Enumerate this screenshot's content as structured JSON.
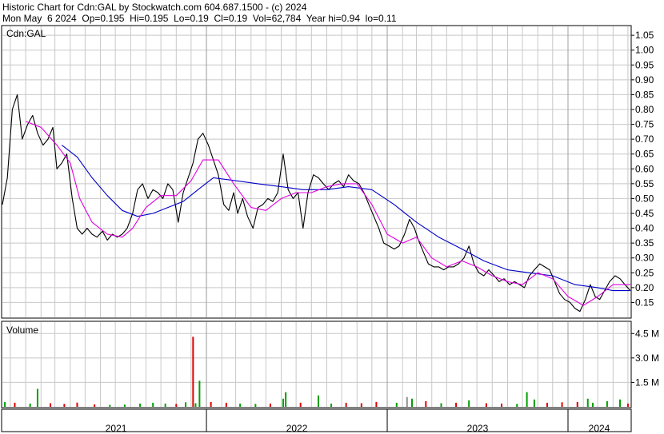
{
  "header": {
    "line1": "Historic Chart for Cdn:GAL by Stockwatch.com 604.687.1500 - (c) 2024",
    "line2": "Mon May  6 2024  Op=0.195  Hi=0.195  Lo=0.19  Cl=0.19  Vol=62,784  Year hi=0.94  lo=0.11"
  },
  "chart_data": {
    "type": "line",
    "symbol_label": "Cdn:GAL",
    "volume_label": "Volume",
    "price_axis": {
      "ylim": [
        0.1,
        1.08
      ],
      "ticks": [
        1.05,
        1.0,
        0.95,
        0.9,
        0.85,
        0.8,
        0.75,
        0.7,
        0.65,
        0.6,
        0.55,
        0.5,
        0.45,
        0.4,
        0.35,
        0.3,
        0.25,
        0.2,
        0.15
      ],
      "tick_labels": [
        "1.05",
        "1.00",
        "0.95",
        "0.90",
        "0.85",
        "0.80",
        "0.75",
        "0.70",
        "0.65",
        "0.60",
        "0.55",
        "0.50",
        "0.45",
        "0.40",
        "0.35",
        "0.30",
        "0.25",
        "0.20",
        "0.15"
      ]
    },
    "volume_axis": {
      "ylim": [
        0,
        5200000
      ],
      "ticks": [
        4500000,
        3000000,
        1500000
      ],
      "tick_labels": [
        "4.5 M",
        "3.0 M",
        "1.5 M"
      ]
    },
    "x_axis": {
      "start": "2020-11-15",
      "end": "2024-05-06",
      "years": [
        {
          "label": "2021",
          "start": "2021-01-01"
        },
        {
          "label": "2022",
          "start": "2022-01-01"
        },
        {
          "label": "2023",
          "start": "2023-01-01"
        },
        {
          "label": "2024",
          "start": "2024-01-01"
        }
      ]
    },
    "grid": true,
    "colors": {
      "price": "#000000",
      "ma_short": "#e000e0",
      "ma_long": "#0000c8",
      "volume_up": "#00a000",
      "volume_down": "#e00000",
      "volume_neutral": "#909090",
      "grid": "#c8c8c8"
    },
    "series": [
      {
        "key": "price",
        "points": [
          [
            "2020-11-15",
            0.48
          ],
          [
            "2020-11-25",
            0.57
          ],
          [
            "2020-12-05",
            0.8
          ],
          [
            "2020-12-15",
            0.85
          ],
          [
            "2020-12-25",
            0.7
          ],
          [
            "2021-01-05",
            0.75
          ],
          [
            "2021-01-15",
            0.78
          ],
          [
            "2021-01-25",
            0.72
          ],
          [
            "2021-02-05",
            0.68
          ],
          [
            "2021-02-15",
            0.7
          ],
          [
            "2021-02-25",
            0.74
          ],
          [
            "2021-03-05",
            0.6
          ],
          [
            "2021-03-15",
            0.62
          ],
          [
            "2021-03-25",
            0.65
          ],
          [
            "2021-04-05",
            0.5
          ],
          [
            "2021-04-15",
            0.4
          ],
          [
            "2021-04-25",
            0.38
          ],
          [
            "2021-05-05",
            0.4
          ],
          [
            "2021-05-15",
            0.38
          ],
          [
            "2021-05-25",
            0.37
          ],
          [
            "2021-06-05",
            0.39
          ],
          [
            "2021-06-15",
            0.36
          ],
          [
            "2021-06-25",
            0.38
          ],
          [
            "2021-07-05",
            0.37
          ],
          [
            "2021-07-15",
            0.38
          ],
          [
            "2021-07-25",
            0.4
          ],
          [
            "2021-08-05",
            0.45
          ],
          [
            "2021-08-15",
            0.53
          ],
          [
            "2021-08-25",
            0.55
          ],
          [
            "2021-09-05",
            0.5
          ],
          [
            "2021-09-15",
            0.53
          ],
          [
            "2021-09-25",
            0.52
          ],
          [
            "2021-10-05",
            0.5
          ],
          [
            "2021-10-15",
            0.55
          ],
          [
            "2021-10-25",
            0.53
          ],
          [
            "2021-11-05",
            0.42
          ],
          [
            "2021-11-15",
            0.52
          ],
          [
            "2021-11-25",
            0.57
          ],
          [
            "2021-12-05",
            0.62
          ],
          [
            "2021-12-15",
            0.7
          ],
          [
            "2021-12-25",
            0.72
          ],
          [
            "2022-01-05",
            0.68
          ],
          [
            "2022-01-15",
            0.63
          ],
          [
            "2022-01-25",
            0.58
          ],
          [
            "2022-02-05",
            0.48
          ],
          [
            "2022-02-15",
            0.46
          ],
          [
            "2022-02-25",
            0.52
          ],
          [
            "2022-03-05",
            0.45
          ],
          [
            "2022-03-15",
            0.5
          ],
          [
            "2022-03-25",
            0.44
          ],
          [
            "2022-04-05",
            0.4
          ],
          [
            "2022-04-15",
            0.47
          ],
          [
            "2022-04-25",
            0.48
          ],
          [
            "2022-05-05",
            0.5
          ],
          [
            "2022-05-15",
            0.49
          ],
          [
            "2022-05-25",
            0.52
          ],
          [
            "2022-06-05",
            0.65
          ],
          [
            "2022-06-15",
            0.53
          ],
          [
            "2022-06-25",
            0.5
          ],
          [
            "2022-07-05",
            0.52
          ],
          [
            "2022-07-15",
            0.4
          ],
          [
            "2022-07-25",
            0.52
          ],
          [
            "2022-08-05",
            0.58
          ],
          [
            "2022-08-15",
            0.57
          ],
          [
            "2022-08-25",
            0.55
          ],
          [
            "2022-09-05",
            0.53
          ],
          [
            "2022-09-15",
            0.55
          ],
          [
            "2022-09-25",
            0.56
          ],
          [
            "2022-10-05",
            0.54
          ],
          [
            "2022-10-15",
            0.58
          ],
          [
            "2022-10-25",
            0.56
          ],
          [
            "2022-11-05",
            0.55
          ],
          [
            "2022-11-15",
            0.52
          ],
          [
            "2022-11-25",
            0.48
          ],
          [
            "2022-12-05",
            0.44
          ],
          [
            "2022-12-15",
            0.4
          ],
          [
            "2022-12-25",
            0.35
          ],
          [
            "2023-01-05",
            0.34
          ],
          [
            "2023-01-15",
            0.33
          ],
          [
            "2023-01-25",
            0.34
          ],
          [
            "2023-02-05",
            0.38
          ],
          [
            "2023-02-15",
            0.43
          ],
          [
            "2023-02-25",
            0.4
          ],
          [
            "2023-03-05",
            0.36
          ],
          [
            "2023-03-15",
            0.32
          ],
          [
            "2023-03-25",
            0.28
          ],
          [
            "2023-04-05",
            0.27
          ],
          [
            "2023-04-15",
            0.27
          ],
          [
            "2023-04-25",
            0.26
          ],
          [
            "2023-05-05",
            0.27
          ],
          [
            "2023-05-15",
            0.27
          ],
          [
            "2023-05-25",
            0.28
          ],
          [
            "2023-06-05",
            0.3
          ],
          [
            "2023-06-15",
            0.34
          ],
          [
            "2023-06-25",
            0.28
          ],
          [
            "2023-07-05",
            0.25
          ],
          [
            "2023-07-15",
            0.24
          ],
          [
            "2023-07-25",
            0.26
          ],
          [
            "2023-08-05",
            0.24
          ],
          [
            "2023-08-15",
            0.22
          ],
          [
            "2023-08-25",
            0.23
          ],
          [
            "2023-09-05",
            0.21
          ],
          [
            "2023-09-15",
            0.22
          ],
          [
            "2023-09-25",
            0.21
          ],
          [
            "2023-10-05",
            0.2
          ],
          [
            "2023-10-15",
            0.24
          ],
          [
            "2023-10-25",
            0.26
          ],
          [
            "2023-11-05",
            0.28
          ],
          [
            "2023-11-15",
            0.27
          ],
          [
            "2023-11-25",
            0.26
          ],
          [
            "2023-12-05",
            0.22
          ],
          [
            "2023-12-15",
            0.18
          ],
          [
            "2023-12-25",
            0.16
          ],
          [
            "2024-01-05",
            0.15
          ],
          [
            "2024-01-15",
            0.13
          ],
          [
            "2024-01-25",
            0.12
          ],
          [
            "2024-02-05",
            0.16
          ],
          [
            "2024-02-15",
            0.21
          ],
          [
            "2024-02-25",
            0.17
          ],
          [
            "2024-03-05",
            0.16
          ],
          [
            "2024-03-15",
            0.19
          ],
          [
            "2024-03-25",
            0.22
          ],
          [
            "2024-04-05",
            0.24
          ],
          [
            "2024-04-15",
            0.23
          ],
          [
            "2024-04-25",
            0.21
          ],
          [
            "2024-05-06",
            0.19
          ]
        ]
      },
      {
        "key": "ma_short",
        "points": [
          [
            "2021-01-01",
            0.76
          ],
          [
            "2021-02-01",
            0.74
          ],
          [
            "2021-03-05",
            0.68
          ],
          [
            "2021-04-01",
            0.62
          ],
          [
            "2021-04-20",
            0.5
          ],
          [
            "2021-05-15",
            0.42
          ],
          [
            "2021-06-15",
            0.38
          ],
          [
            "2021-07-15",
            0.37
          ],
          [
            "2021-08-05",
            0.4
          ],
          [
            "2021-09-01",
            0.47
          ],
          [
            "2021-10-01",
            0.51
          ],
          [
            "2021-11-01",
            0.51
          ],
          [
            "2021-12-01",
            0.56
          ],
          [
            "2021-12-25",
            0.63
          ],
          [
            "2022-01-25",
            0.63
          ],
          [
            "2022-02-25",
            0.55
          ],
          [
            "2022-04-01",
            0.47
          ],
          [
            "2022-05-01",
            0.46
          ],
          [
            "2022-06-01",
            0.5
          ],
          [
            "2022-07-01",
            0.52
          ],
          [
            "2022-08-01",
            0.52
          ],
          [
            "2022-09-01",
            0.54
          ],
          [
            "2022-10-01",
            0.55
          ],
          [
            "2022-11-01",
            0.55
          ],
          [
            "2022-12-01",
            0.48
          ],
          [
            "2023-01-01",
            0.38
          ],
          [
            "2023-02-01",
            0.35
          ],
          [
            "2023-03-01",
            0.37
          ],
          [
            "2023-04-01",
            0.3
          ],
          [
            "2023-05-01",
            0.27
          ],
          [
            "2023-06-01",
            0.29
          ],
          [
            "2023-07-01",
            0.27
          ],
          [
            "2023-08-01",
            0.24
          ],
          [
            "2023-09-01",
            0.22
          ],
          [
            "2023-10-01",
            0.21
          ],
          [
            "2023-11-01",
            0.25
          ],
          [
            "2023-12-01",
            0.23
          ],
          [
            "2024-01-01",
            0.17
          ],
          [
            "2024-02-01",
            0.14
          ],
          [
            "2024-03-01",
            0.17
          ],
          [
            "2024-04-01",
            0.21
          ],
          [
            "2024-05-06",
            0.21
          ]
        ]
      },
      {
        "key": "ma_long",
        "points": [
          [
            "2021-03-15",
            0.68
          ],
          [
            "2021-04-15",
            0.64
          ],
          [
            "2021-05-15",
            0.57
          ],
          [
            "2021-06-15",
            0.51
          ],
          [
            "2021-07-15",
            0.46
          ],
          [
            "2021-08-15",
            0.44
          ],
          [
            "2021-09-15",
            0.45
          ],
          [
            "2021-10-15",
            0.47
          ],
          [
            "2021-11-15",
            0.49
          ],
          [
            "2021-12-15",
            0.53
          ],
          [
            "2022-01-15",
            0.57
          ],
          [
            "2022-03-01",
            0.56
          ],
          [
            "2022-04-15",
            0.55
          ],
          [
            "2022-06-01",
            0.54
          ],
          [
            "2022-07-15",
            0.53
          ],
          [
            "2022-09-01",
            0.53
          ],
          [
            "2022-10-15",
            0.54
          ],
          [
            "2022-12-01",
            0.53
          ],
          [
            "2023-01-15",
            0.48
          ],
          [
            "2023-03-01",
            0.42
          ],
          [
            "2023-04-15",
            0.37
          ],
          [
            "2023-06-01",
            0.33
          ],
          [
            "2023-07-15",
            0.29
          ],
          [
            "2023-09-01",
            0.26
          ],
          [
            "2023-10-15",
            0.25
          ],
          [
            "2023-12-01",
            0.24
          ],
          [
            "2024-01-15",
            0.21
          ],
          [
            "2024-03-01",
            0.2
          ],
          [
            "2024-04-01",
            0.19
          ],
          [
            "2024-05-06",
            0.19
          ]
        ]
      }
    ],
    "volume": {
      "points": [
        [
          "2020-11-20",
          300000,
          "up"
        ],
        [
          "2020-12-10",
          250000,
          "down"
        ],
        [
          "2021-01-10",
          200000,
          "up"
        ],
        [
          "2021-01-25",
          1100000,
          "up"
        ],
        [
          "2021-02-20",
          220000,
          "down"
        ],
        [
          "2021-03-20",
          180000,
          "down"
        ],
        [
          "2021-04-15",
          260000,
          "down"
        ],
        [
          "2021-05-20",
          150000,
          "down"
        ],
        [
          "2021-06-20",
          120000,
          "up"
        ],
        [
          "2021-07-20",
          140000,
          "up"
        ],
        [
          "2021-08-20",
          200000,
          "up"
        ],
        [
          "2021-09-15",
          250000,
          "up"
        ],
        [
          "2021-10-10",
          200000,
          "up"
        ],
        [
          "2021-11-01",
          180000,
          "down"
        ],
        [
          "2021-11-20",
          280000,
          "up"
        ],
        [
          "2021-12-05",
          4300000,
          "down"
        ],
        [
          "2021-12-10",
          220000,
          "up"
        ],
        [
          "2021-12-18",
          1600000,
          "up"
        ],
        [
          "2022-01-10",
          300000,
          "down"
        ],
        [
          "2022-02-10",
          250000,
          "down"
        ],
        [
          "2022-03-10",
          200000,
          "up"
        ],
        [
          "2022-04-10",
          180000,
          "up"
        ],
        [
          "2022-05-10",
          200000,
          "down"
        ],
        [
          "2022-06-05",
          500000,
          "up"
        ],
        [
          "2022-06-10",
          900000,
          "up"
        ],
        [
          "2022-07-10",
          250000,
          "down"
        ],
        [
          "2022-08-15",
          700000,
          "up"
        ],
        [
          "2022-09-10",
          200000,
          "up"
        ],
        [
          "2022-10-10",
          250000,
          "down"
        ],
        [
          "2022-11-10",
          220000,
          "down"
        ],
        [
          "2022-12-10",
          300000,
          "down"
        ],
        [
          "2023-01-20",
          250000,
          "up"
        ],
        [
          "2023-02-10",
          600000,
          "neutral"
        ],
        [
          "2023-02-20",
          500000,
          "up"
        ],
        [
          "2023-03-20",
          350000,
          "down"
        ],
        [
          "2023-04-20",
          220000,
          "up"
        ],
        [
          "2023-05-20",
          250000,
          "down"
        ],
        [
          "2023-06-15",
          400000,
          "up"
        ],
        [
          "2023-07-20",
          220000,
          "down"
        ],
        [
          "2023-08-20",
          200000,
          "down"
        ],
        [
          "2023-09-20",
          180000,
          "up"
        ],
        [
          "2023-10-10",
          900000,
          "up"
        ],
        [
          "2023-10-25",
          450000,
          "up"
        ],
        [
          "2023-11-20",
          250000,
          "down"
        ],
        [
          "2023-12-20",
          280000,
          "down"
        ],
        [
          "2024-01-20",
          300000,
          "down"
        ],
        [
          "2024-02-10",
          500000,
          "up"
        ],
        [
          "2024-02-20",
          250000,
          "up"
        ],
        [
          "2024-03-20",
          350000,
          "up"
        ],
        [
          "2024-04-15",
          450000,
          "up"
        ],
        [
          "2024-05-01",
          200000,
          "down"
        ]
      ]
    }
  }
}
